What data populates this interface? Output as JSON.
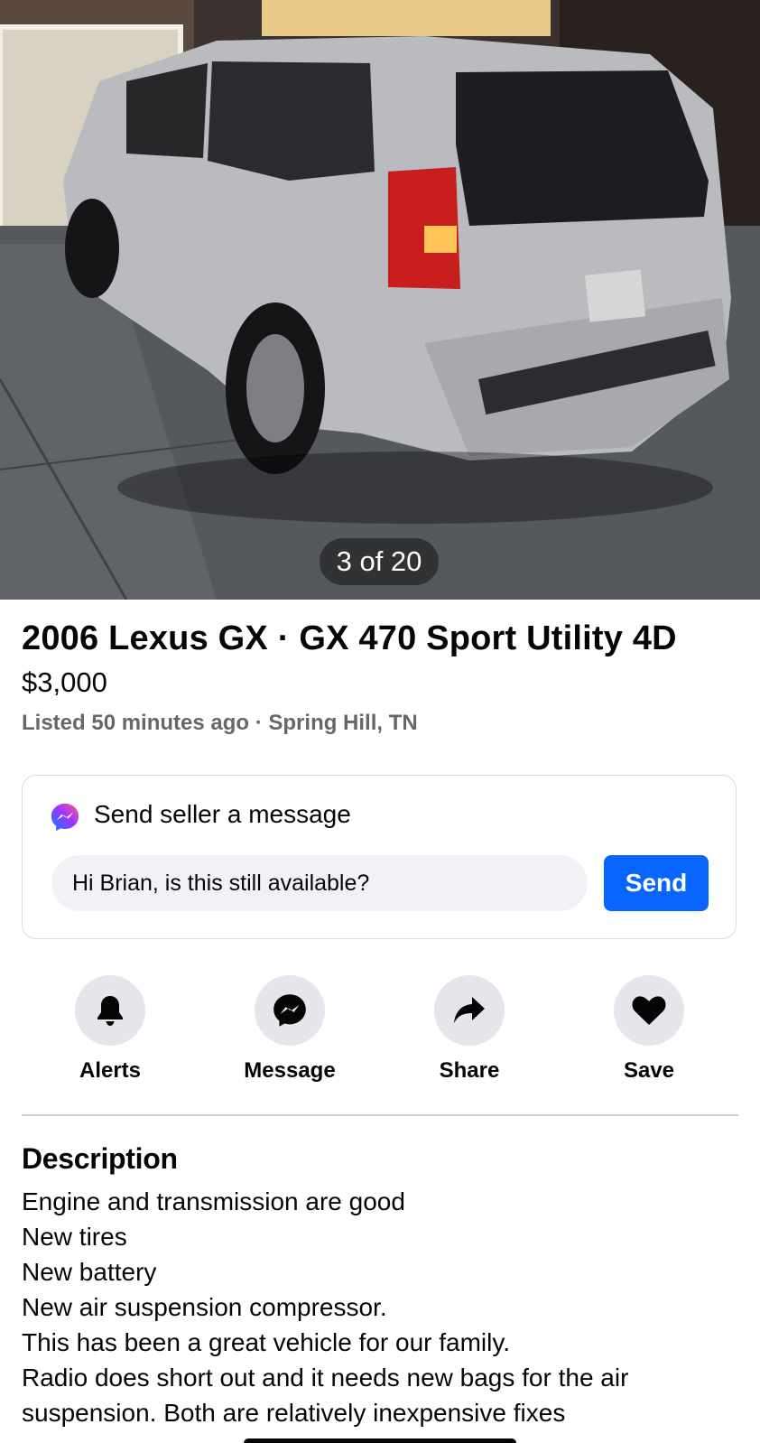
{
  "photo": {
    "counter": "3 of 20"
  },
  "listing": {
    "title": "2006 Lexus GX · GX 470 Sport Utility 4D",
    "price": "$3,000",
    "meta": "Listed 50 minutes ago · Spring Hill, TN"
  },
  "message_card": {
    "icon": "messenger-icon",
    "title": "Send seller a message",
    "input_value": "Hi Brian, is this still available?",
    "send_label": "Send"
  },
  "actions": [
    {
      "label": "Alerts",
      "icon": "bell-icon"
    },
    {
      "label": "Message",
      "icon": "messenger-icon"
    },
    {
      "label": "Share",
      "icon": "share-arrow-icon"
    },
    {
      "label": "Save",
      "icon": "heart-icon"
    }
  ],
  "description": {
    "heading": "Description",
    "lines": [
      "Engine and transmission are good",
      "New tires",
      "New battery",
      "New air suspension compressor.",
      "This has been a great vehicle for our family.",
      "Radio does short out and it needs new bags for the air",
      "suspension. Both are relatively inexpensive fixes"
    ]
  },
  "colors": {
    "accent": "#0866ff",
    "secondary_text": "#65676b",
    "input_bg": "#f0f2f5",
    "icon_circle": "#e4e6eb"
  }
}
